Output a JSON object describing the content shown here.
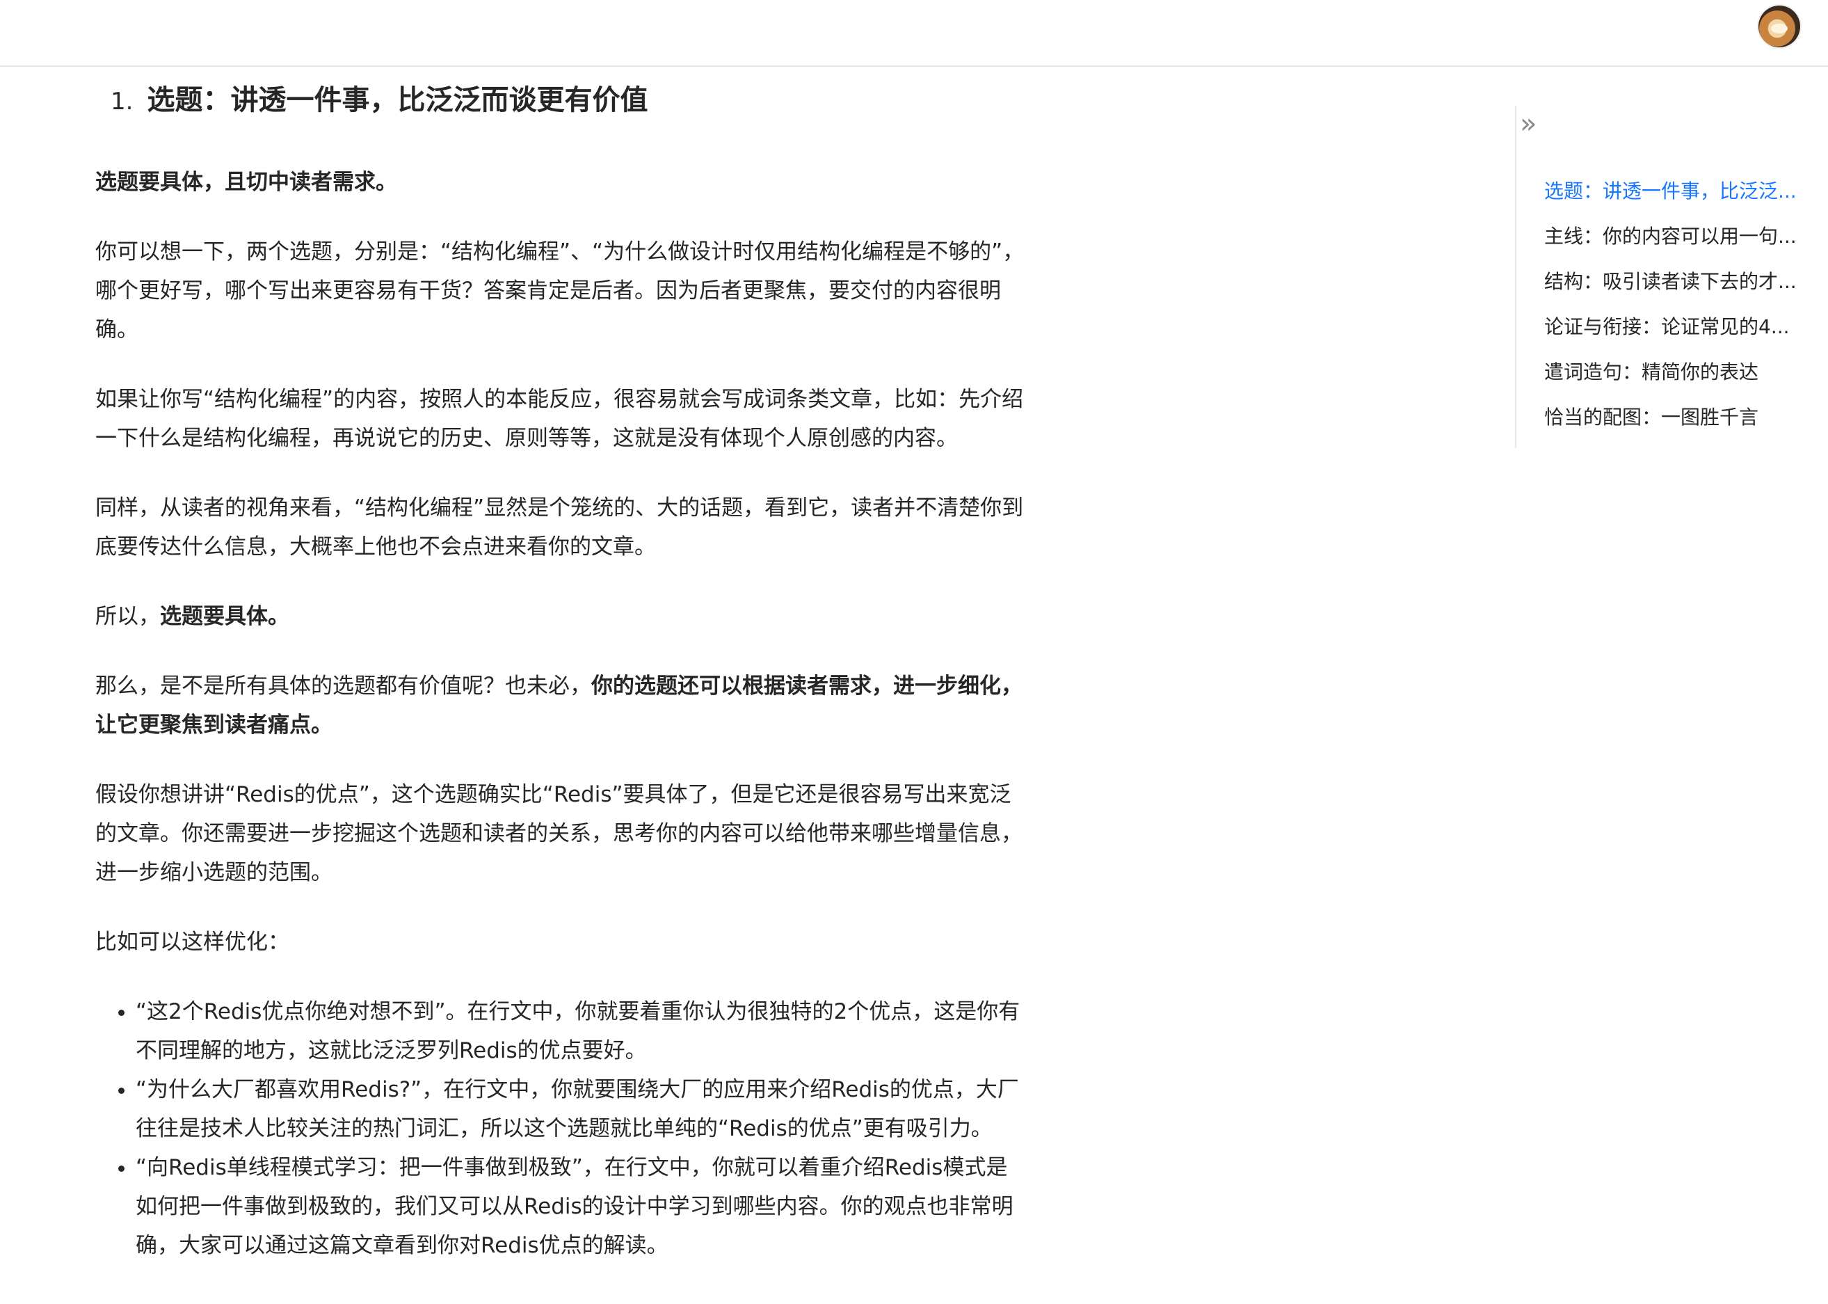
{
  "header": {
    "avatar_icon": "user-avatar-icon"
  },
  "article": {
    "heading_number": "1.",
    "heading_title": "选题：讲透一件事，比泛泛而谈更有价值",
    "p1": "选题要具体，且切中读者需求。",
    "p2": "你可以想一下，两个选题，分别是：“结构化编程”、“为什么做设计时仅用结构化编程是不够的”，哪个更好写，哪个写出来更容易有干货？答案肯定是后者。因为后者更聚焦，要交付的内容很明确。",
    "p3": "如果让你写“结构化编程”的内容，按照人的本能反应，很容易就会写成词条类文章，比如：先介绍一下什么是结构化编程，再说说它的历史、原则等等，这就是没有体现个人原创感的内容。",
    "p4": "同样，从读者的视角来看，“结构化编程”显然是个笼统的、大的话题，看到它，读者并不清楚你到底要传达什么信息，大概率上他也不会点进来看你的文章。",
    "p5_prefix": "所以，",
    "p5_bold": "选题要具体。",
    "p6_prefix": "那么，是不是所有具体的选题都有价值呢？也未必，",
    "p6_bold": "你的选题还可以根据读者需求，进一步细化，让它更聚焦到读者痛点。",
    "p7": "假设你想讲讲“Redis的优点”，这个选题确实比“Redis”要具体了，但是它还是很容易写出来宽泛的文章。你还需要进一步挖掘这个选题和读者的关系，思考你的内容可以给他带来哪些增量信息，进一步缩小选题的范围。",
    "p8": "比如可以这样优化：",
    "bullets": [
      "“这2个Redis优点你绝对想不到”。在行文中，你就要着重你认为很独特的2个优点，这是你有不同理解的地方，这就比泛泛罗列Redis的优点要好。",
      "“为什么大厂都喜欢用Redis?”，在行文中，你就要围绕大厂的应用来介绍Redis的优点，大厂往往是技术人比较关注的热门词汇，所以这个选题就比单纯的“Redis的优点”更有吸引力。",
      "“向Redis单线程模式学习：把一件事做到极致”，在行文中，你就可以着重介绍Redis模式是如何把一件事做到极致的，我们又可以从Redis的设计中学习到哪些内容。你的观点也非常明确，大家可以通过这篇文章看到你对Redis优点的解读。"
    ]
  },
  "toc": {
    "toggle_glyph": "»",
    "toggle_icon": "double-chevron-right-icon",
    "items": [
      "选题：讲透一件事，比泛泛...",
      "主线：你的内容可以用一句...",
      "结构：吸引读者读下去的才...",
      "论证与衔接：论证常见的4...",
      "遣词造句：精简你的表达",
      "恰当的配图：一图胜千言"
    ],
    "active_color": "#1677ff"
  }
}
